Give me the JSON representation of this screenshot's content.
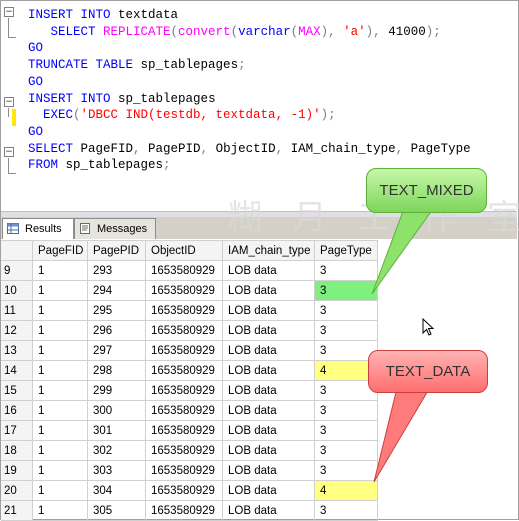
{
  "editor": {
    "lines": [
      {
        "parts": [
          {
            "t": "INSERT",
            "c": "kw"
          },
          {
            "t": " ",
            "c": "plain"
          },
          {
            "t": "INTO",
            "c": "kw"
          },
          {
            "t": " textdata",
            "c": "plain"
          }
        ]
      },
      {
        "parts": [
          {
            "t": "   SELECT ",
            "c": "kw"
          },
          {
            "t": "REPLICATE",
            "c": "fn"
          },
          {
            "t": "(",
            "c": "gray"
          },
          {
            "t": "convert",
            "c": "fn"
          },
          {
            "t": "(",
            "c": "gray"
          },
          {
            "t": "varchar",
            "c": "kw"
          },
          {
            "t": "(",
            "c": "gray"
          },
          {
            "t": "MAX",
            "c": "fn"
          },
          {
            "t": "),",
            "c": "gray"
          },
          {
            "t": " ",
            "c": "plain"
          },
          {
            "t": "'a'",
            "c": "str"
          },
          {
            "t": "),",
            "c": "gray"
          },
          {
            "t": " 41000",
            "c": "plain"
          },
          {
            "t": ");",
            "c": "gray"
          }
        ]
      },
      {
        "parts": [
          {
            "t": "GO",
            "c": "kw"
          }
        ]
      },
      {
        "parts": [
          {
            "t": "TRUNCATE",
            "c": "kw"
          },
          {
            "t": " ",
            "c": "plain"
          },
          {
            "t": "TABLE",
            "c": "kw"
          },
          {
            "t": " sp_tablepages",
            "c": "plain"
          },
          {
            "t": ";",
            "c": "gray"
          }
        ]
      },
      {
        "parts": [
          {
            "t": "GO",
            "c": "kw"
          }
        ]
      },
      {
        "parts": [
          {
            "t": "INSERT",
            "c": "kw"
          },
          {
            "t": " ",
            "c": "plain"
          },
          {
            "t": "INTO",
            "c": "kw"
          },
          {
            "t": " sp_tablepages",
            "c": "plain"
          }
        ]
      },
      {
        "parts": [
          {
            "t": "  EXEC",
            "c": "kw"
          },
          {
            "t": "(",
            "c": "gray"
          },
          {
            "t": "'DBCC IND(testdb, textdata, -1)'",
            "c": "str"
          },
          {
            "t": ");",
            "c": "gray"
          }
        ]
      },
      {
        "parts": [
          {
            "t": "GO",
            "c": "kw"
          }
        ]
      },
      {
        "parts": [
          {
            "t": "SELECT",
            "c": "kw"
          },
          {
            "t": " PageFID",
            "c": "plain"
          },
          {
            "t": ",",
            "c": "gray"
          },
          {
            "t": " PagePID",
            "c": "plain"
          },
          {
            "t": ",",
            "c": "gray"
          },
          {
            "t": " ObjectID",
            "c": "plain"
          },
          {
            "t": ",",
            "c": "gray"
          },
          {
            "t": " IAM_chain_type",
            "c": "plain"
          },
          {
            "t": ",",
            "c": "gray"
          },
          {
            "t": " PageType",
            "c": "plain"
          }
        ]
      },
      {
        "parts": [
          {
            "t": "FROM",
            "c": "kw"
          },
          {
            "t": " sp_tablepages",
            "c": "plain"
          },
          {
            "t": ";",
            "c": "gray"
          }
        ]
      }
    ]
  },
  "tabs": {
    "results_label": "Results",
    "messages_label": "Messages"
  },
  "grid": {
    "columns": [
      "",
      "PageFID",
      "PagePID",
      "ObjectID",
      "IAM_chain_type",
      "PageType"
    ],
    "rows": [
      {
        "rn": "9",
        "fid": "1",
        "pid": "293",
        "oid": "1653580929",
        "iam": "LOB data",
        "pt": "3",
        "hl": ""
      },
      {
        "rn": "10",
        "fid": "1",
        "pid": "294",
        "oid": "1653580929",
        "iam": "LOB data",
        "pt": "3",
        "hl": "green"
      },
      {
        "rn": "11",
        "fid": "1",
        "pid": "295",
        "oid": "1653580929",
        "iam": "LOB data",
        "pt": "3",
        "hl": ""
      },
      {
        "rn": "12",
        "fid": "1",
        "pid": "296",
        "oid": "1653580929",
        "iam": "LOB data",
        "pt": "3",
        "hl": ""
      },
      {
        "rn": "13",
        "fid": "1",
        "pid": "297",
        "oid": "1653580929",
        "iam": "LOB data",
        "pt": "3",
        "hl": ""
      },
      {
        "rn": "14",
        "fid": "1",
        "pid": "298",
        "oid": "1653580929",
        "iam": "LOB data",
        "pt": "4",
        "hl": "yellow"
      },
      {
        "rn": "15",
        "fid": "1",
        "pid": "299",
        "oid": "1653580929",
        "iam": "LOB data",
        "pt": "3",
        "hl": ""
      },
      {
        "rn": "16",
        "fid": "1",
        "pid": "300",
        "oid": "1653580929",
        "iam": "LOB data",
        "pt": "3",
        "hl": ""
      },
      {
        "rn": "17",
        "fid": "1",
        "pid": "301",
        "oid": "1653580929",
        "iam": "LOB data",
        "pt": "3",
        "hl": ""
      },
      {
        "rn": "18",
        "fid": "1",
        "pid": "302",
        "oid": "1653580929",
        "iam": "LOB data",
        "pt": "3",
        "hl": ""
      },
      {
        "rn": "19",
        "fid": "1",
        "pid": "303",
        "oid": "1653580929",
        "iam": "LOB data",
        "pt": "3",
        "hl": ""
      },
      {
        "rn": "20",
        "fid": "1",
        "pid": "304",
        "oid": "1653580929",
        "iam": "LOB data",
        "pt": "4",
        "hl": "yellow"
      },
      {
        "rn": "21",
        "fid": "1",
        "pid": "305",
        "oid": "1653580929",
        "iam": "LOB data",
        "pt": "3",
        "hl": ""
      }
    ]
  },
  "callouts": {
    "mixed_label": "TEXT_MIXED",
    "data_label": "TEXT_DATA"
  },
  "watermark": "糊 月 工 作 室",
  "colors": {
    "keyword": "#0000ff",
    "function": "#ff00ff",
    "string": "#ff0000",
    "green_highlight": "#7ff07f",
    "yellow_highlight": "#ffff80",
    "green_callout": "#8de36a",
    "red_callout": "#ff7b7b"
  }
}
